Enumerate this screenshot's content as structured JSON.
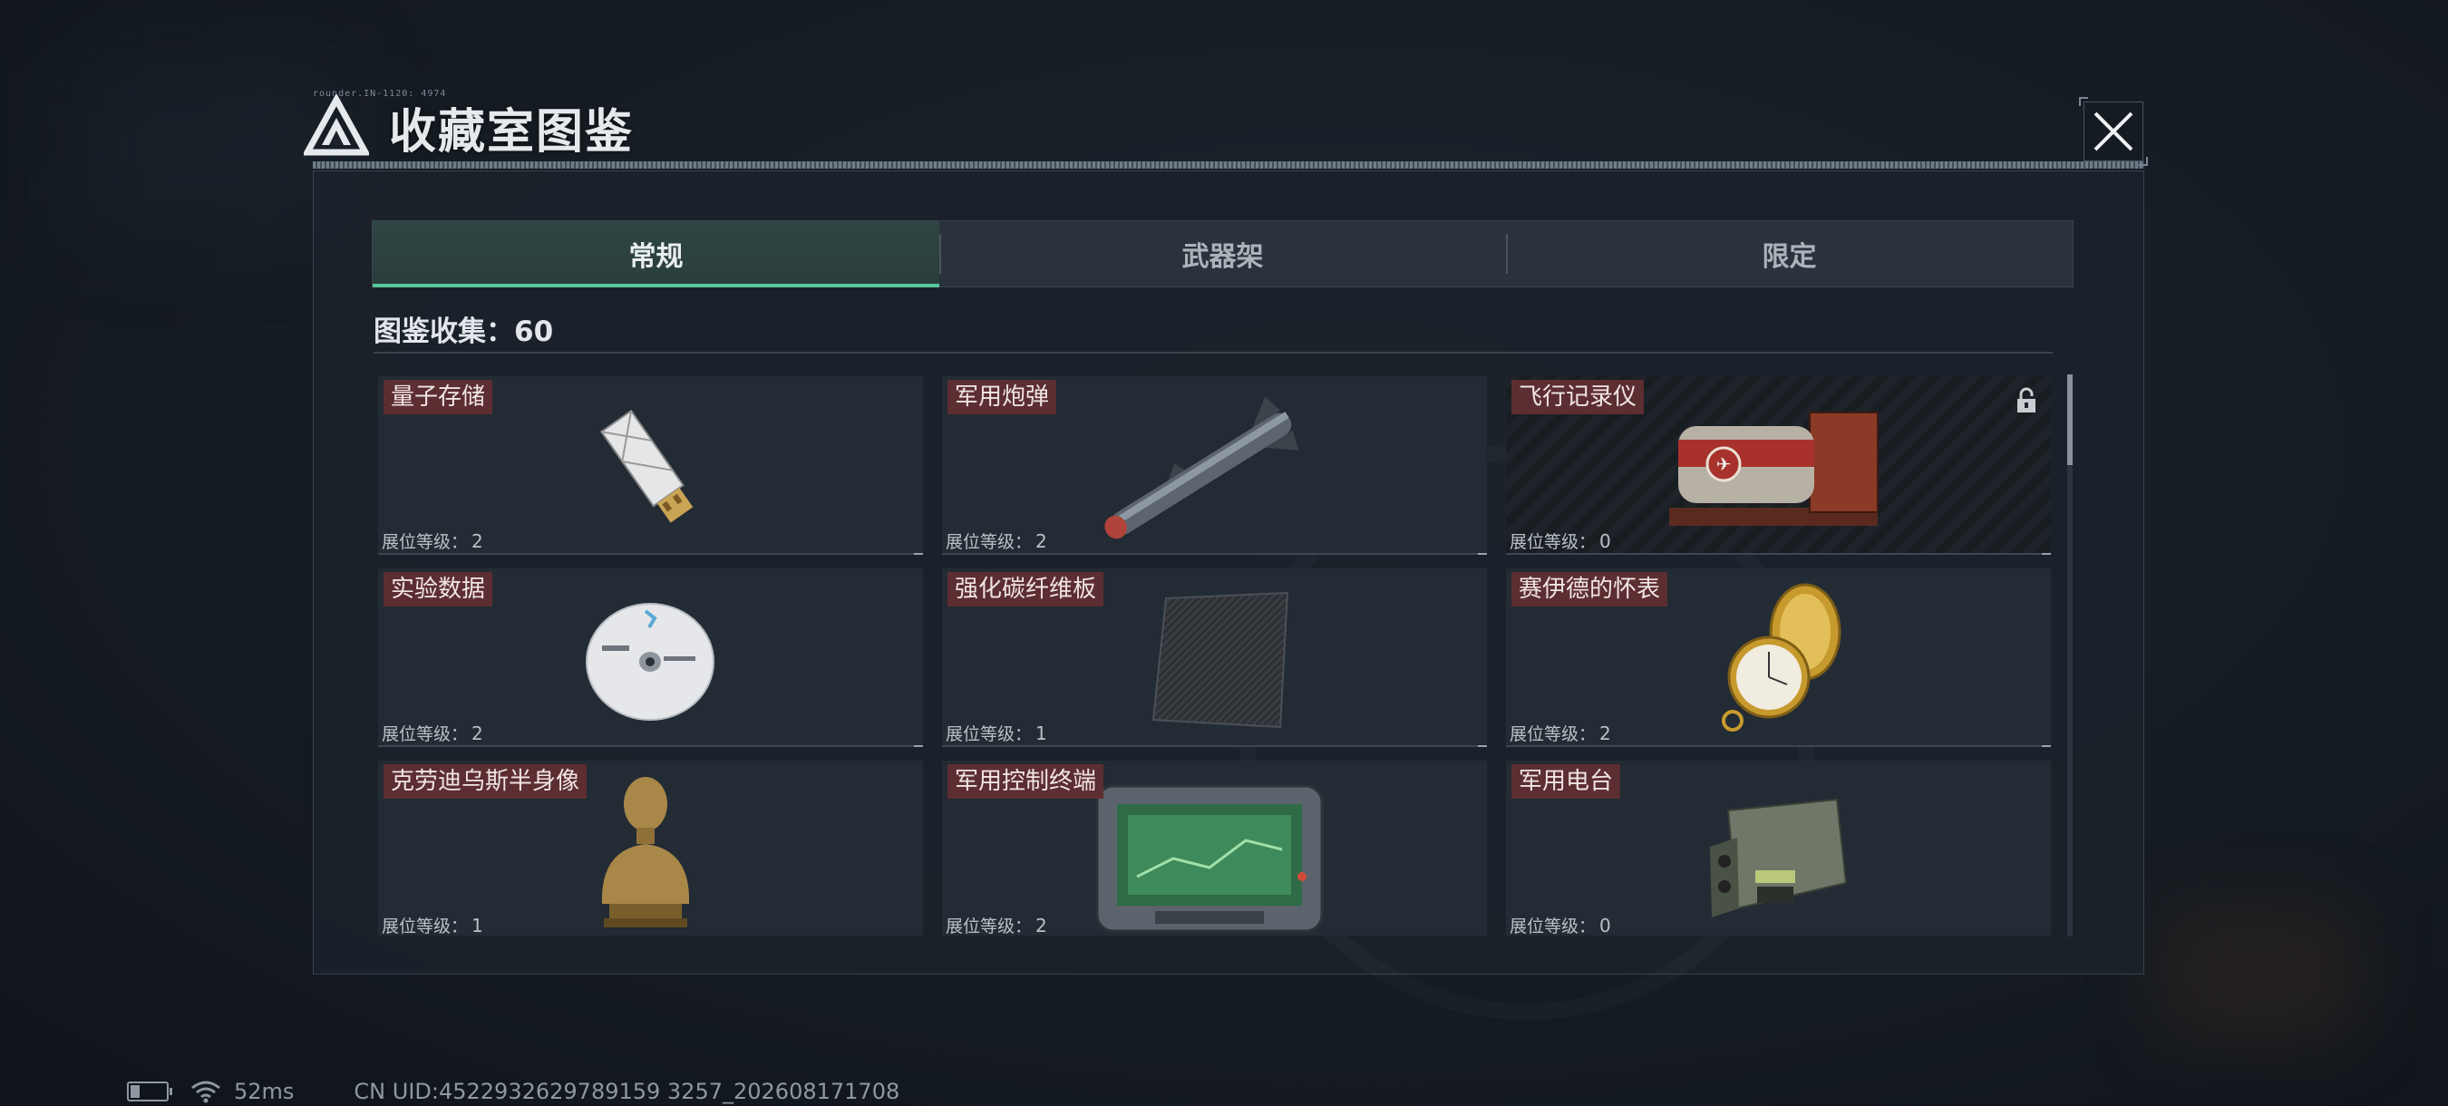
{
  "header": {
    "title": "收藏室图鉴",
    "micro_text": "rounder.IN-1120: 4974"
  },
  "tabs": [
    {
      "label": "常规",
      "active": true
    },
    {
      "label": "武器架",
      "active": false
    },
    {
      "label": "限定",
      "active": false
    }
  ],
  "collection": {
    "label": "图鉴收集：",
    "count": "60"
  },
  "level_label": "展位等级：",
  "items": [
    {
      "name": "量子存储",
      "level": "2",
      "locked": false,
      "icon": "usb-drive"
    },
    {
      "name": "军用炮弹",
      "level": "2",
      "locked": false,
      "icon": "missile"
    },
    {
      "name": "飞行记录仪",
      "level": "0",
      "locked": true,
      "icon": "flight-recorder"
    },
    {
      "name": "实验数据",
      "level": "2",
      "locked": false,
      "icon": "disc"
    },
    {
      "name": "强化碳纤维板",
      "level": "1",
      "locked": false,
      "icon": "carbon-plate"
    },
    {
      "name": "赛伊德的怀表",
      "level": "2",
      "locked": false,
      "icon": "pocket-watch"
    },
    {
      "name": "克劳迪乌斯半身像",
      "level": "1",
      "locked": false,
      "icon": "bust"
    },
    {
      "name": "军用控制终端",
      "level": "2",
      "locked": false,
      "icon": "control-terminal"
    },
    {
      "name": "军用电台",
      "level": "0",
      "locked": false,
      "icon": "radio"
    }
  ],
  "status_bar": {
    "ping": "52ms",
    "uid": "CN UID:4522932629789159 3257_202608171708"
  },
  "colors": {
    "accent": "#58c79a",
    "name_tag": "#5c2e31",
    "panel": "#1b222a"
  }
}
